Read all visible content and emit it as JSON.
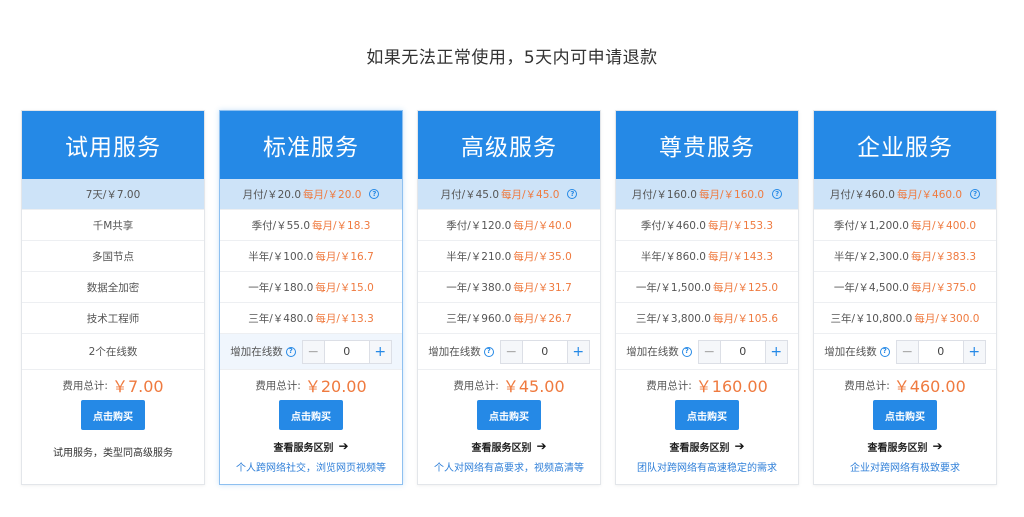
{
  "page_title": "如果无法正常使用，5天内可申请退款",
  "trial": {
    "title": "试用服务",
    "price": "7天/￥7.00",
    "features": [
      "千M共享",
      "多国节点",
      "数据全加密",
      "技术工程师",
      "2个在线数"
    ],
    "total_label": "费用总计:",
    "total": "￥7.00",
    "buy_label": "点击购买",
    "desc": "试用服务，类型同高级服务"
  },
  "plans": [
    {
      "title": "标准服务",
      "prices": [
        {
          "label": "月付/￥20.0",
          "monthly": "每月/￥20.0"
        },
        {
          "label": "季付/￥55.0",
          "monthly": "每月/￥18.3"
        },
        {
          "label": "半年/￥100.0",
          "monthly": "每月/￥16.7"
        },
        {
          "label": "一年/￥180.0",
          "monthly": "每月/￥15.0"
        },
        {
          "label": "三年/￥480.0",
          "monthly": "每月/￥13.3"
        }
      ],
      "qty_label": "增加在线数",
      "qty_value": "0",
      "total_label": "费用总计:",
      "total": "￥20.00",
      "buy_label": "点击购买",
      "compare_label": "查看服务区别",
      "desc": "个人跨网络社交，浏览网页视频等"
    },
    {
      "title": "高级服务",
      "prices": [
        {
          "label": "月付/￥45.0",
          "monthly": "每月/￥45.0"
        },
        {
          "label": "季付/￥120.0",
          "monthly": "每月/￥40.0"
        },
        {
          "label": "半年/￥210.0",
          "monthly": "每月/￥35.0"
        },
        {
          "label": "一年/￥380.0",
          "monthly": "每月/￥31.7"
        },
        {
          "label": "三年/￥960.0",
          "monthly": "每月/￥26.7"
        }
      ],
      "qty_label": "增加在线数",
      "qty_value": "0",
      "total_label": "费用总计:",
      "total": "￥45.00",
      "buy_label": "点击购买",
      "compare_label": "查看服务区别",
      "desc": "个人对网络有高要求，视频高清等"
    },
    {
      "title": "尊贵服务",
      "prices": [
        {
          "label": "月付/￥160.0",
          "monthly": "每月/￥160.0"
        },
        {
          "label": "季付/￥460.0",
          "monthly": "每月/￥153.3"
        },
        {
          "label": "半年/￥860.0",
          "monthly": "每月/￥143.3"
        },
        {
          "label": "一年/￥1,500.0",
          "monthly": "每月/￥125.0"
        },
        {
          "label": "三年/￥3,800.0",
          "monthly": "每月/￥105.6"
        }
      ],
      "qty_label": "增加在线数",
      "qty_value": "0",
      "total_label": "费用总计:",
      "total": "￥160.00",
      "buy_label": "点击购买",
      "compare_label": "查看服务区别",
      "desc": "团队对跨网络有高速稳定的需求"
    },
    {
      "title": "企业服务",
      "prices": [
        {
          "label": "月付/￥460.0",
          "monthly": "每月/￥460.0"
        },
        {
          "label": "季付/￥1,200.0",
          "monthly": "每月/￥400.0"
        },
        {
          "label": "半年/￥2,300.0",
          "monthly": "每月/￥383.3"
        },
        {
          "label": "一年/￥4,500.0",
          "monthly": "每月/￥375.0"
        },
        {
          "label": "三年/￥10,800.0",
          "monthly": "每月/￥300.0"
        }
      ],
      "qty_label": "增加在线数",
      "qty_value": "0",
      "total_label": "费用总计:",
      "total": "￥460.00",
      "buy_label": "点击购买",
      "compare_label": "查看服务区别",
      "desc": "企业对跨网络有极致要求"
    }
  ],
  "icons": {
    "help": "question-circle-icon",
    "arrow": "arrow-right-icon",
    "minus": "minus-icon",
    "plus": "plus-icon"
  },
  "colors": {
    "primary": "#2589e6",
    "highlight_row": "#cde3f8",
    "price_accent": "#ef7a3f",
    "desc_link": "#2f7fd8"
  }
}
